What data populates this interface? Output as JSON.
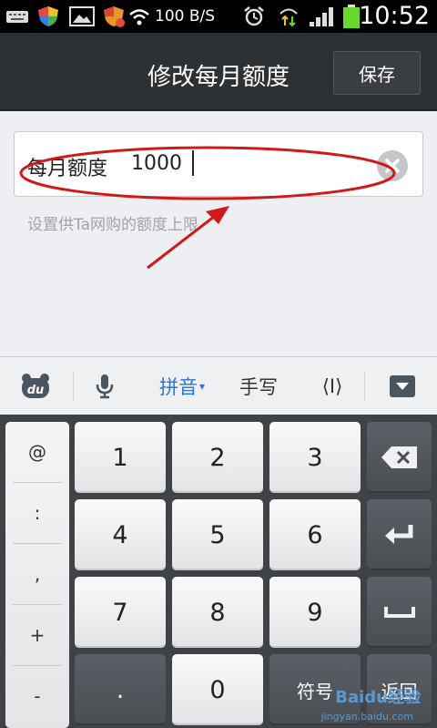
{
  "status_bar": {
    "network_speed": "100 B/S",
    "time": "10:52",
    "icons": [
      "keyboard-icon",
      "shield-icon",
      "image-icon",
      "shield-alert-icon",
      "wifi-icon",
      "alarm-icon",
      "data-transfer-icon",
      "signal-icon",
      "battery-icon"
    ],
    "battery_color": "#6bd62b"
  },
  "header": {
    "title": "修改每月额度",
    "save_label": "保存"
  },
  "form": {
    "label": "每月额度",
    "value": "1000",
    "hint": "设置供Ta网购的额度上限",
    "annotation_color": "#d0191b"
  },
  "ime_toolbar": {
    "logo": "du",
    "pinyin_label": "拼音",
    "handwriting_label": "手写",
    "cursor_label": "⟨I⟩"
  },
  "keyboard": {
    "symbols": [
      "@",
      ":",
      ",",
      "+",
      "-"
    ],
    "digits": [
      "1",
      "2",
      "3",
      "4",
      "5",
      "6",
      "7",
      "8",
      "9",
      "0"
    ],
    "dot_label": ".",
    "symbol_key_label": "符号",
    "back_key_label": "返回"
  },
  "watermark": {
    "brand": "Baidu经验",
    "url": "jingyan.baidu.com"
  }
}
